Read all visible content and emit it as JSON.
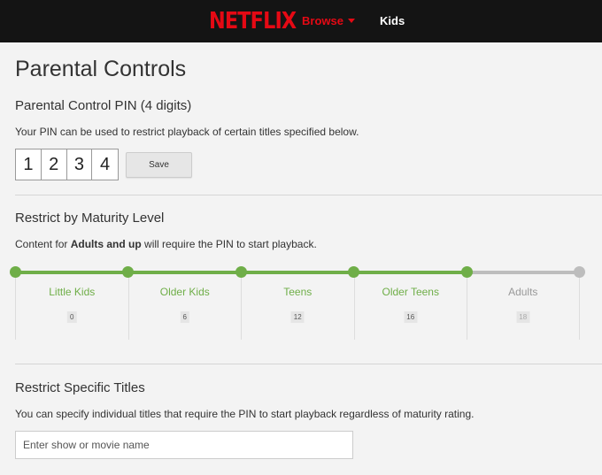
{
  "header": {
    "logo_text": "NETFLIX",
    "browse_label": "Browse",
    "kids_label": "Kids",
    "colors": {
      "bar": "#141414",
      "brand": "#e50914"
    }
  },
  "page": {
    "title": "Parental Controls"
  },
  "pin_section": {
    "title": "Parental Control PIN (4 digits)",
    "description": "Your PIN can be used to restrict playback of certain titles specified below.",
    "digits": [
      "1",
      "2",
      "3",
      "4"
    ],
    "save_label": "Save"
  },
  "maturity_section": {
    "title": "Restrict by Maturity Level",
    "desc_prefix": "Content for ",
    "desc_bold": "Adults and up",
    "desc_suffix": " will require the PIN to start playback.",
    "active_color": "#6fae48",
    "inactive_color": "#bdbdbd",
    "selected_level_index": 4,
    "levels": [
      {
        "name": "Little Kids",
        "age": "0",
        "active": true
      },
      {
        "name": "Older Kids",
        "age": "6",
        "active": true
      },
      {
        "name": "Teens",
        "age": "12",
        "active": true
      },
      {
        "name": "Older Teens",
        "age": "16",
        "active": true
      },
      {
        "name": "Adults",
        "age": "18",
        "active": false
      }
    ]
  },
  "titles_section": {
    "title": "Restrict Specific Titles",
    "description": "You can specify individual titles that require the PIN to start playback regardless of maturity rating.",
    "search_placeholder": "Enter show or movie name",
    "search_value": ""
  }
}
